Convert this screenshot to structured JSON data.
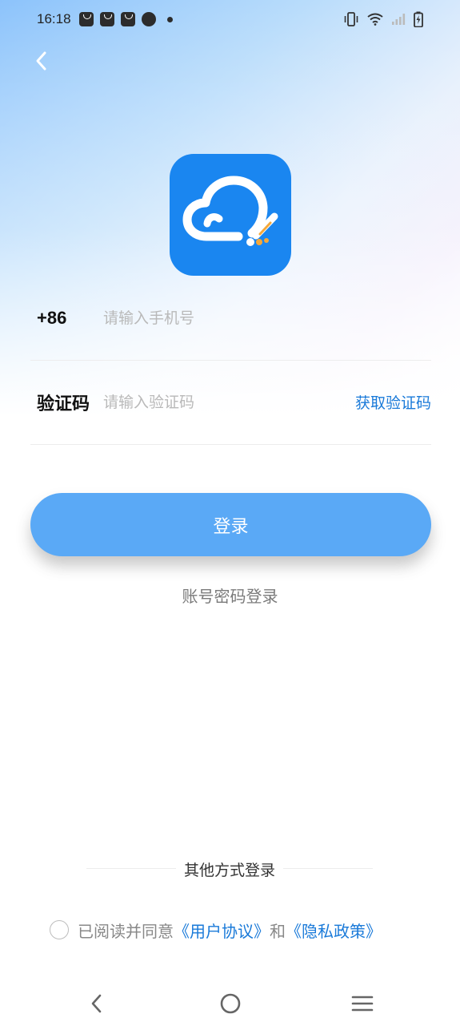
{
  "status_bar": {
    "time": "16:18",
    "icons": [
      "notification-bag-icon",
      "notification-bag-icon",
      "notification-bag-icon",
      "gauge-icon",
      "dot-icon",
      "vibrate-icon",
      "wifi-icon",
      "signal-icon",
      "battery-charging-icon"
    ]
  },
  "header": {
    "back_icon": "chevron-left-icon"
  },
  "logo": {
    "icon": "cloud-pen-icon",
    "bg_color": "#1a86f0",
    "accent_color": "#f5a83a"
  },
  "form": {
    "phone": {
      "prefix": "+86",
      "placeholder": "请输入手机号",
      "value": ""
    },
    "code": {
      "label": "验证码",
      "placeholder": "请输入验证码",
      "value": "",
      "get_code_label": "获取验证码"
    }
  },
  "login_button": {
    "label": "登录",
    "color": "#5aa9f6"
  },
  "password_login_label": "账号密码登录",
  "other_login_label": "其他方式登录",
  "agreement": {
    "checked": false,
    "prefix": "已阅读并同意",
    "user_agreement": "《用户协议》",
    "conjunction": "和",
    "privacy_policy": "《隐私政策》",
    "link_color": "#1a7ad9"
  },
  "nav_bar": {
    "icons": [
      "nav-back-icon",
      "nav-home-icon",
      "nav-menu-icon"
    ]
  }
}
